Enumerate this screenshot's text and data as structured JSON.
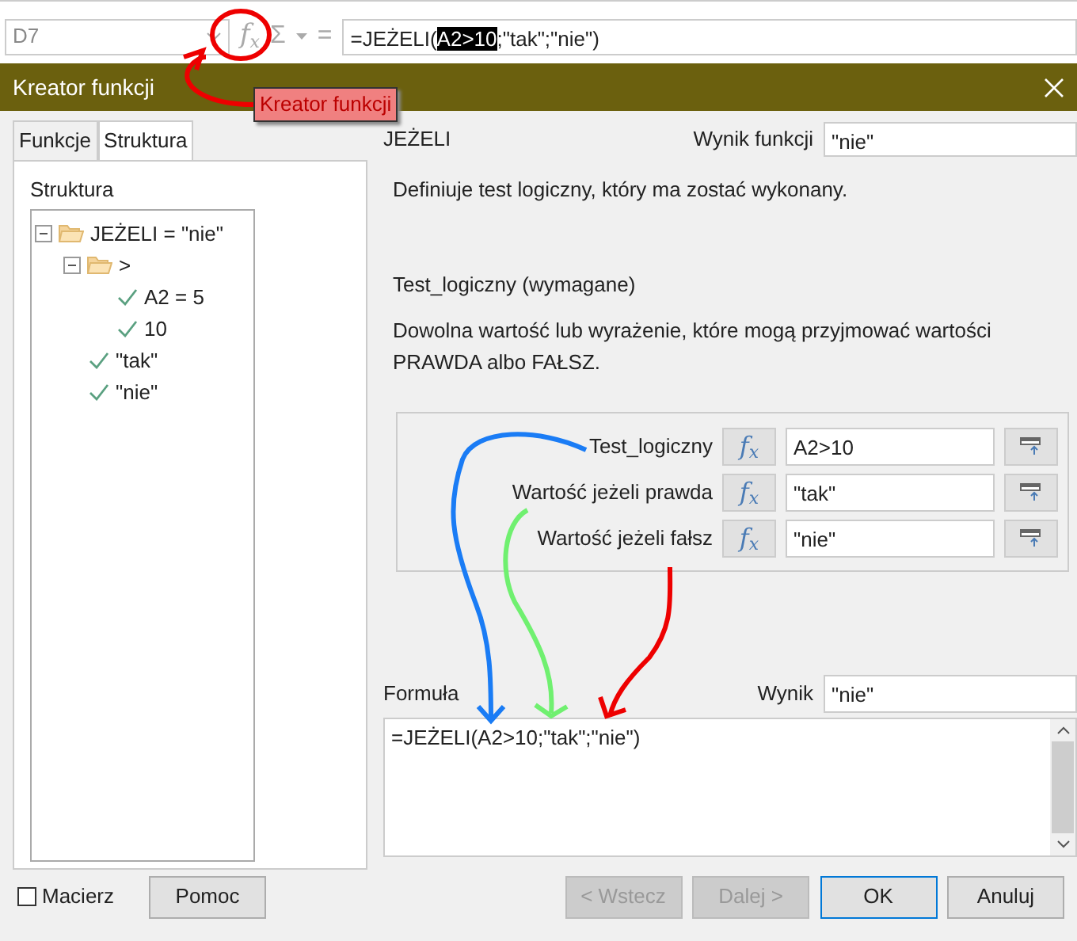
{
  "toolbar": {
    "name_box": "D7",
    "sum_glyph": "Σ",
    "equals_glyph": "=",
    "fx_glyph": "f$_{x}$",
    "tooltip": "Kreator funkcji",
    "formula_segments": [
      {
        "text": "=JEŻELI(",
        "selected": false
      },
      {
        "text": "A2>10",
        "selected": true
      },
      {
        "text": ";\"tak\";\"nie\")",
        "selected": false
      }
    ]
  },
  "dialog": {
    "title": "Kreator funkcji",
    "tabs": [
      {
        "label": "Funkcje",
        "selected": false
      },
      {
        "label": "Struktura",
        "selected": true
      }
    ],
    "structure_label": "Struktura",
    "tree": [
      {
        "label": "JEŻELI = \"nie\"",
        "kind": "folder",
        "expanded": true,
        "children": [
          {
            "label": ">",
            "kind": "folder",
            "expanded": true,
            "children": [
              {
                "label": "A2 = 5",
                "kind": "value"
              },
              {
                "label": "10",
                "kind": "value"
              }
            ]
          },
          {
            "label": "\"tak\"",
            "kind": "value"
          },
          {
            "label": "\"nie\"",
            "kind": "value"
          }
        ]
      }
    ],
    "function_name": "JEŻELI",
    "function_result_label": "Wynik funkcji",
    "function_result": "\"nie\"",
    "description": "Definiuje test logiczny, który ma zostać wykonany.",
    "argument_title": "Test_logiczny (wymagane)",
    "argument_description": "Dowolna wartość lub wyrażenie, które mogą przyjmować wartości PRAWDA albo FAŁSZ.",
    "arguments": [
      {
        "label": "Test_logiczny",
        "fx": "f$_{x}$",
        "value": "A2>10"
      },
      {
        "label": "Wartość jeżeli prawda",
        "fx": "f$_{x}$",
        "value": "\"tak\""
      },
      {
        "label": "Wartość jeżeli fałsz",
        "fx": "f$_{x}$",
        "value": "\"nie\""
      }
    ],
    "formula_label": "Formuła",
    "result_label": "Wynik",
    "result": "\"nie\"",
    "formula": "=JEŻELI(A2>10;\"tak\";\"nie\")",
    "array_checkbox": {
      "label": "Macierz",
      "checked": false
    },
    "help_button": "Pomoc",
    "buttons": [
      {
        "label": "< Wstecz",
        "disabled": true,
        "default": false
      },
      {
        "label": "Dalej >",
        "disabled": true,
        "default": false
      },
      {
        "label": "OK",
        "disabled": false,
        "default": true
      },
      {
        "label": "Anuluj",
        "disabled": false,
        "default": false
      }
    ]
  }
}
